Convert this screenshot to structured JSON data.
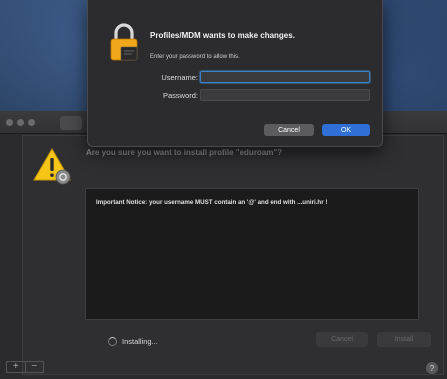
{
  "dialog": {
    "title": "Profiles/MDM wants to make changes.",
    "subtitle": "Enter your password to allow this.",
    "username_label": "Username:",
    "username_value": "",
    "password_label": "Password:",
    "password_value": "",
    "cancel_label": "Cancel",
    "ok_label": "OK",
    "icon": "lock-icon"
  },
  "profile_pane": {
    "question": "Are you sure you want to install profile \"eduroam\"?",
    "notice": "Important Notice: your username MUST contain an '@' and end with ...uniri.hr !",
    "status": "Installing...",
    "cancel_label": "Cancel",
    "install_label": "Install",
    "add_label": "+",
    "remove_label": "−",
    "help_label": "?",
    "icon": "warning-icon"
  },
  "colors": {
    "accent": "#2f6fd6",
    "focus_ring": "#3b82c4",
    "dialog_bg": "#2c2c2e",
    "warning_yellow": "#f5c518"
  }
}
